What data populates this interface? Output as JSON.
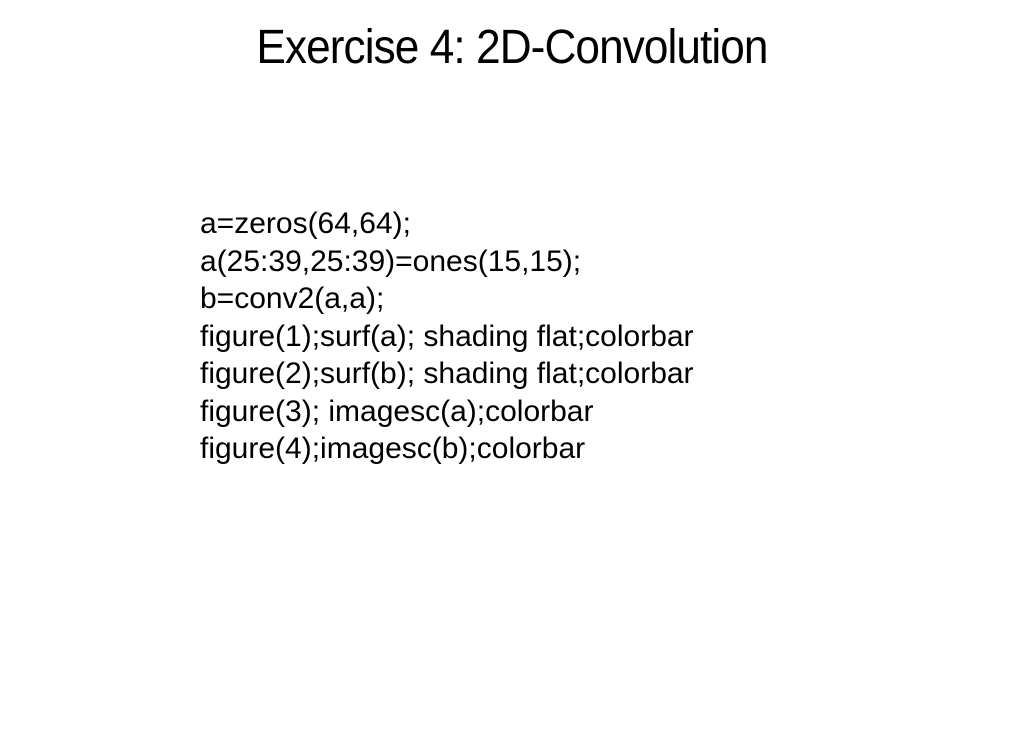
{
  "slide": {
    "title": "Exercise 4: 2D-Convolution",
    "code_lines": [
      "a=zeros(64,64);",
      "a(25:39,25:39)=ones(15,15);",
      "b=conv2(a,a);",
      "figure(1);surf(a); shading flat;colorbar",
      "figure(2);surf(b); shading flat;colorbar",
      "figure(3); imagesc(a);colorbar",
      "figure(4);imagesc(b);colorbar"
    ]
  }
}
